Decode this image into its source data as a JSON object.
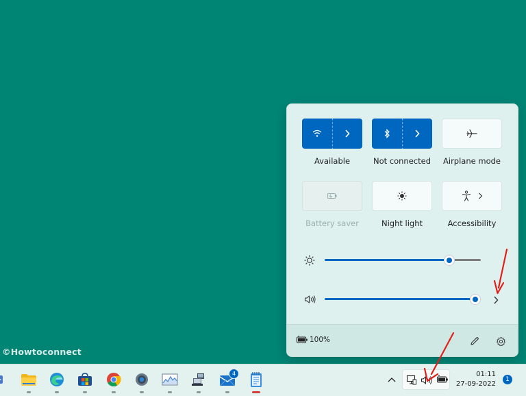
{
  "watermark": "©Howtoconnect",
  "quick_settings": {
    "tiles": [
      {
        "label": "Available",
        "icon": "wifi-icon",
        "state": "on"
      },
      {
        "label": "Not connected",
        "icon": "bluetooth-icon",
        "state": "on"
      },
      {
        "label": "Airplane mode",
        "icon": "airplane-icon",
        "state": "off"
      },
      {
        "label": "Battery saver",
        "icon": "battery-saver-icon",
        "state": "disabled"
      },
      {
        "label": "Night light",
        "icon": "night-light-icon",
        "state": "off"
      },
      {
        "label": "Accessibility",
        "icon": "accessibility-icon",
        "state": "off"
      }
    ],
    "brightness": {
      "level": 0.82,
      "icon": "brightness-icon"
    },
    "volume": {
      "level": 1.0,
      "icon": "speaker-icon"
    },
    "footer": {
      "battery_percent": "100%",
      "edit_icon": "pencil-icon",
      "settings_icon": "gear-icon"
    }
  },
  "taskbar": {
    "apps": [
      {
        "name": "file-explorer"
      },
      {
        "name": "edge"
      },
      {
        "name": "microsoft-store"
      },
      {
        "name": "chrome"
      },
      {
        "name": "settings"
      },
      {
        "name": "task-manager"
      },
      {
        "name": "network-app"
      },
      {
        "name": "mail",
        "badge": "4"
      },
      {
        "name": "notepad"
      }
    ],
    "clock": {
      "time": "01:11",
      "date": "27-09-2022"
    },
    "notification_count": "1"
  },
  "colors": {
    "desktop": "#008575",
    "accent": "#0067c0",
    "arrow": "#e0201b"
  }
}
